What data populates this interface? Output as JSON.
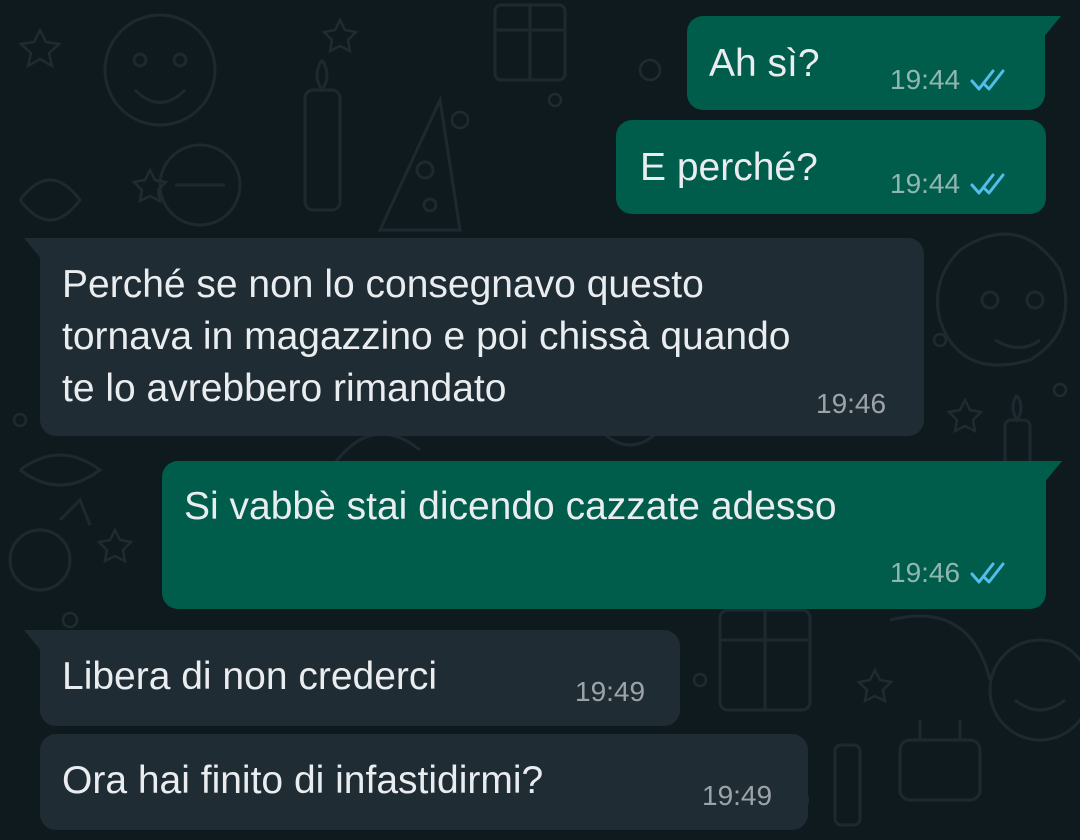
{
  "chat": {
    "messages": [
      {
        "direction": "outgoing",
        "lines": [
          "Ah sì?"
        ],
        "time": "19:44",
        "status": "read",
        "status_icon": "double-check-icon"
      },
      {
        "direction": "outgoing",
        "lines": [
          "E perché?"
        ],
        "time": "19:44",
        "status": "read",
        "status_icon": "double-check-icon"
      },
      {
        "direction": "incoming",
        "lines": [
          "Perché se non lo consegnavo questo",
          "tornava in magazzino e poi chissà quando",
          "te lo avrebbero rimandato"
        ],
        "time": "19:46"
      },
      {
        "direction": "outgoing",
        "lines": [
          "Si vabbè stai dicendo cazzate adesso"
        ],
        "time": "19:46",
        "status": "read",
        "status_icon": "double-check-icon"
      },
      {
        "direction": "incoming",
        "lines": [
          "Libera di non crederci"
        ],
        "time": "19:49"
      },
      {
        "direction": "incoming",
        "lines": [
          "Ora hai finito di infastidirmi?"
        ],
        "time": "19:49"
      }
    ]
  },
  "colors": {
    "outgoing_bubble": "#005c4b",
    "incoming_bubble": "#202c33",
    "wallpaper": "#0f1a1f",
    "read_check": "#53bdeb",
    "text": "#e9edef"
  }
}
